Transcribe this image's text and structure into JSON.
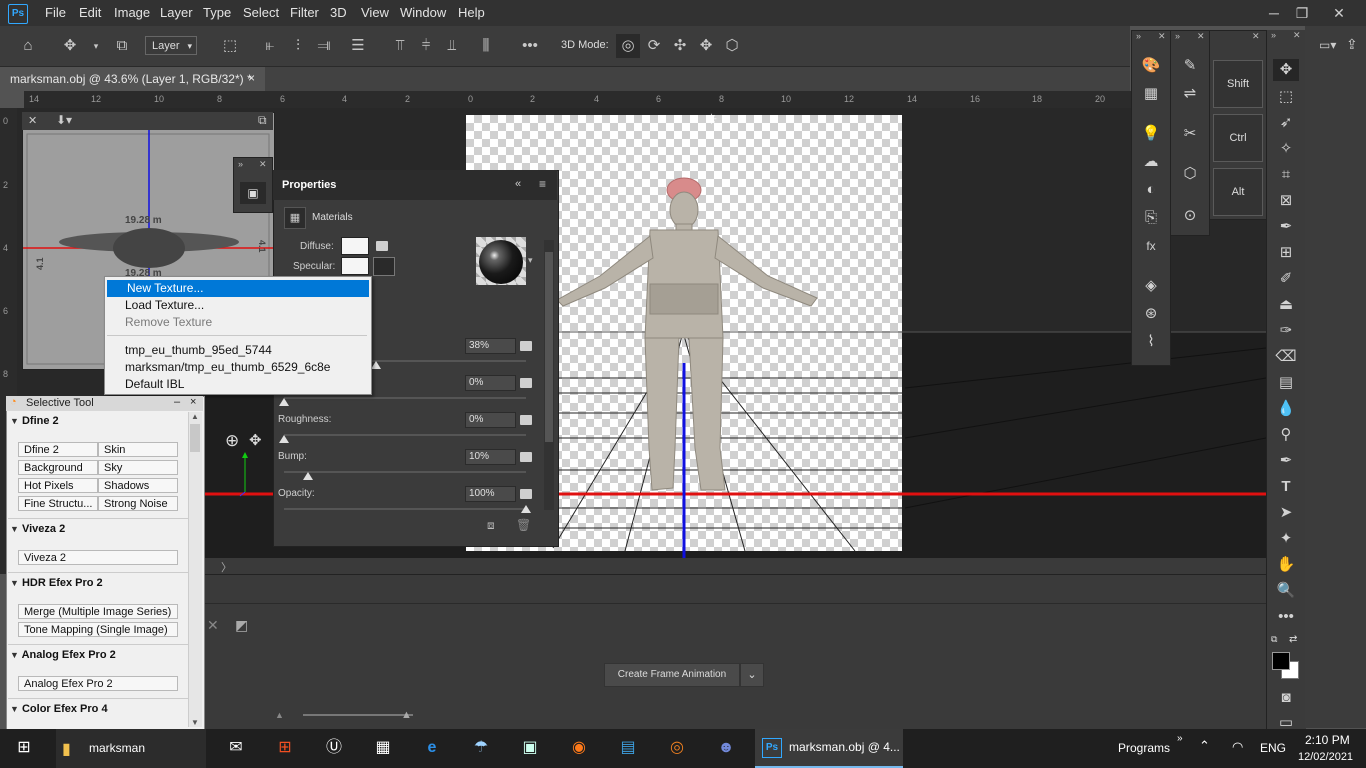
{
  "app": {
    "name": "Ps"
  },
  "menu": [
    "File",
    "Edit",
    "Image",
    "Layer",
    "Type",
    "Select",
    "Filter",
    "3D",
    "View",
    "Window",
    "Help"
  ],
  "options_bar": {
    "layer_select": "Layer",
    "three_d_mode_label": "3D Mode:"
  },
  "document_tab": {
    "title": "marksman.obj @ 43.6% (Layer 1, RGB/32*) *",
    "close": "×"
  },
  "ruler_h": [
    "14",
    "12",
    "10",
    "8",
    "6",
    "4",
    "2",
    "0",
    "2",
    "4",
    "6",
    "8",
    "10",
    "12",
    "14",
    "16",
    "18",
    "20"
  ],
  "ruler_v": [
    "0",
    "2",
    "4",
    "6",
    "8"
  ],
  "mini_view": {
    "dim_top": "19.28 m",
    "dim_bottom": "19.28 m",
    "dim_left": "4.1",
    "dim_right": "4.1"
  },
  "properties_panel": {
    "title": "Properties",
    "section": "Materials",
    "diffuse_label": "Diffuse:",
    "specular_label": "Specular:",
    "roughness_label": "Roughness:",
    "bump_label": "Bump:",
    "opacity_label": "Opacity:",
    "row1_value": "38%",
    "row2_value": "0%",
    "roughness_value": "0%",
    "bump_value": "10%",
    "opacity_value": "100%",
    "slider_levels": {
      "row1": 0.38,
      "row2": 0.0,
      "roughness": 0.0,
      "bump": 0.1,
      "opacity": 1.0
    }
  },
  "context_menu": {
    "items": [
      "New Texture...",
      "Load Texture...",
      "Remove Texture"
    ],
    "recent": [
      "tmp_eu_thumb_95ed_5744",
      "marksman/tmp_eu_thumb_6529_6c8e",
      "Default IBL"
    ]
  },
  "selective_tool": {
    "title": "Selective Tool",
    "dfine": {
      "heading": "Dfine 2",
      "buttons": [
        "Dfine 2",
        "Skin",
        "Background",
        "Sky",
        "Hot Pixels",
        "Shadows",
        "Fine Structu...",
        "Strong Noise"
      ]
    },
    "viveza": {
      "heading": "Viveza 2",
      "buttons": [
        "Viveza 2"
      ]
    },
    "hdr": {
      "heading": "HDR Efex Pro 2",
      "buttons": [
        "Merge (Multiple Image Series)",
        "Tone Mapping (Single Image)"
      ]
    },
    "analog": {
      "heading": "Analog Efex Pro 2",
      "buttons": [
        "Analog Efex Pro 2"
      ]
    },
    "color": {
      "heading": "Color Efex Pro 4"
    }
  },
  "timeline": {
    "create_button": "Create Frame Animation"
  },
  "key_buttons": [
    "Shift",
    "Ctrl",
    "Alt"
  ],
  "taskbar": {
    "explorer_label": "marksman",
    "ps_label": "marksman.obj @ 4...",
    "programs": "Programs",
    "lang": "ENG",
    "time": "2:10 PM",
    "date": "12/02/2021"
  },
  "colors": {
    "accent_ps": "#31a8ff",
    "highlight": "#0078d7",
    "axis_red": "#e01010",
    "axis_blue": "#1010e0"
  }
}
